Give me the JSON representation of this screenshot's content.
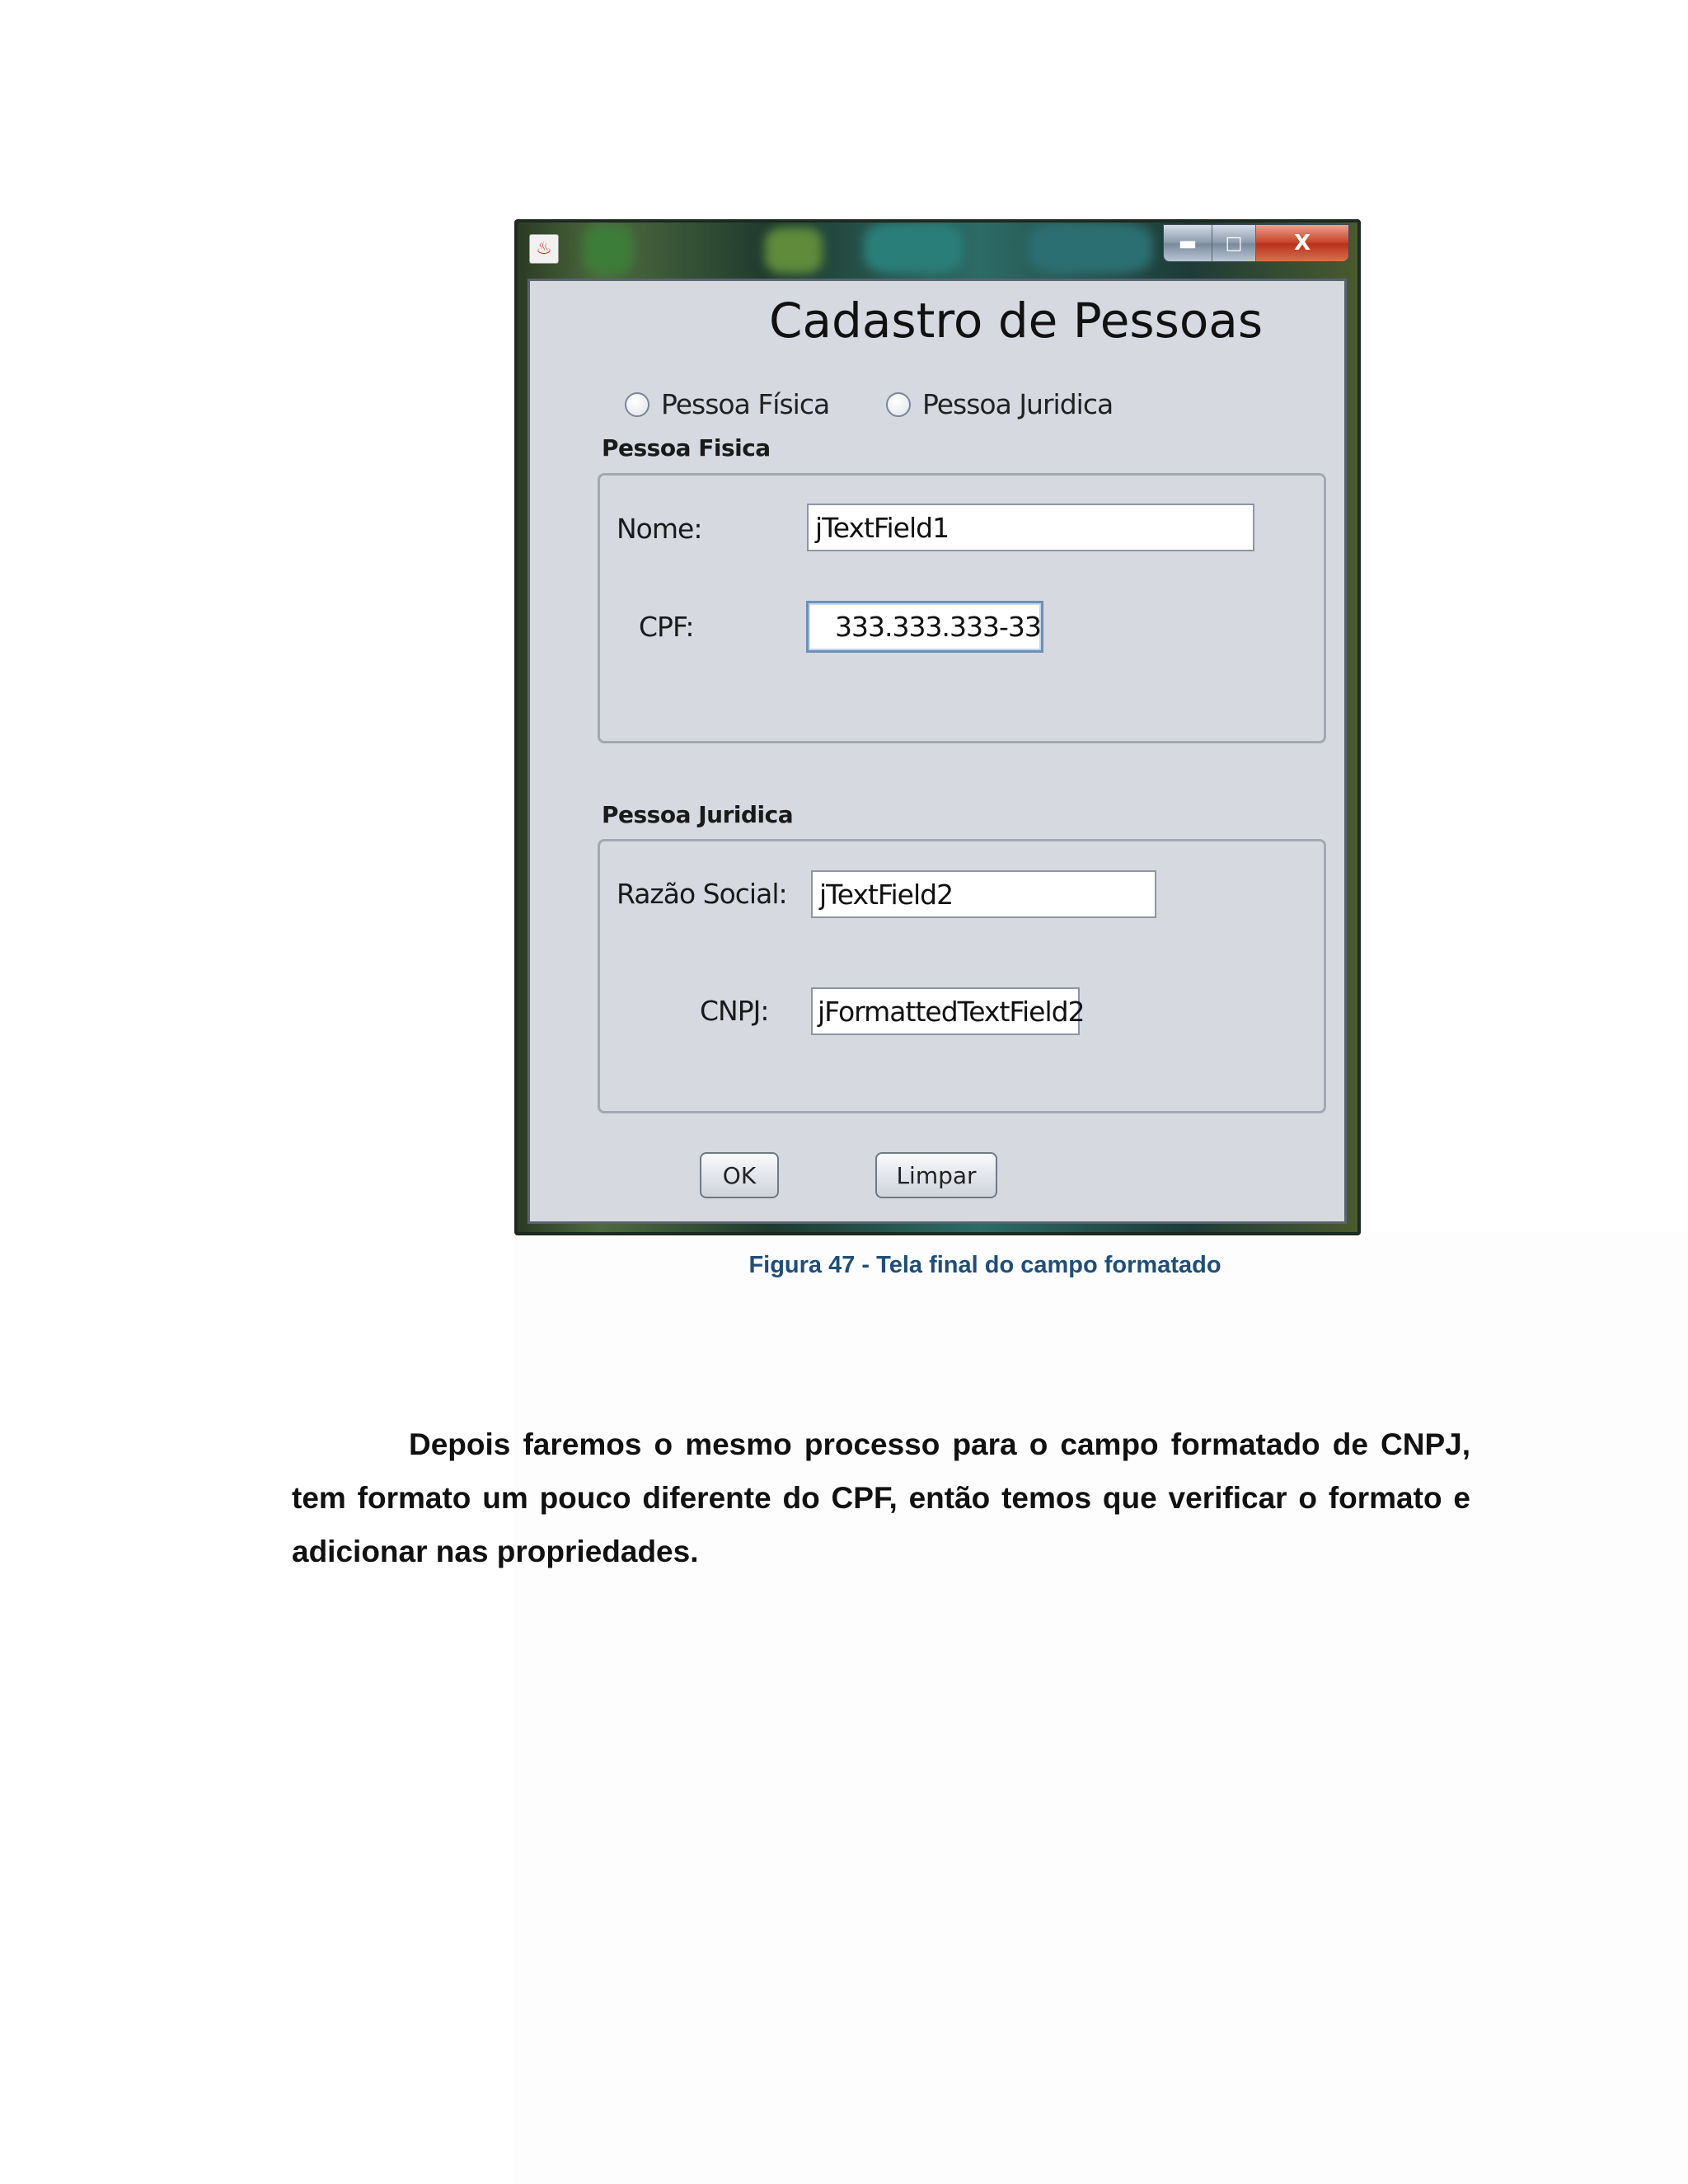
{
  "window": {
    "title": "Cadastro de Pessoas",
    "controls": {
      "minimize": "▬",
      "maximize": "□",
      "close": "X"
    },
    "radios": [
      {
        "label": "Pessoa Física",
        "checked": false
      },
      {
        "label": "Pessoa Juridica",
        "checked": false
      }
    ],
    "pessoa_fisica": {
      "group_title": "Pessoa Fisica",
      "nome_label": "Nome:",
      "nome_value": "jTextField1",
      "cpf_label": "CPF:",
      "cpf_value": "333.333.333-33"
    },
    "pessoa_juridica": {
      "group_title": "Pessoa Juridica",
      "razao_label": "Razão Social:",
      "razao_value": "jTextField2",
      "cnpj_label": "CNPJ:",
      "cnpj_value": "jFormattedTextField2"
    },
    "buttons": {
      "ok": "OK",
      "limpar": "Limpar"
    }
  },
  "caption": "Figura 47 - Tela final do campo formatado",
  "paragraph": "Depois faremos o mesmo processo para o campo formatado de CNPJ, tem formato um pouco diferente do CPF, então temos que verificar o formato e adicionar nas propriedades.",
  "colors": {
    "caption": "#1f4e79",
    "client_background": "#d6d9e0",
    "close_button": "#c9432a"
  }
}
